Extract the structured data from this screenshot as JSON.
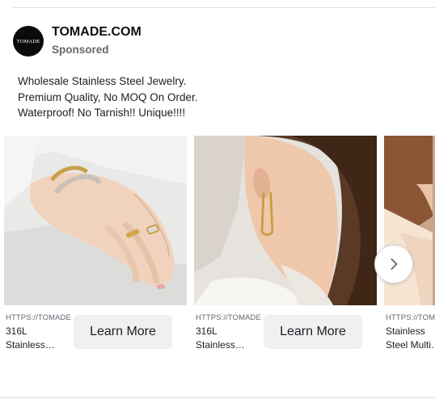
{
  "ad": {
    "advertiser": "TOMADE.COM",
    "avatar_text": "TOMADE",
    "sponsored": "Sponsored",
    "body_lines": [
      "Wholesale Stainless Steel Jewelry.",
      "Premium Quality, No MOQ On Order.",
      "Waterproof! No Tarnish!! Unique!!!!"
    ]
  },
  "carousel": {
    "cards": [
      {
        "image": "hand-with-rings-and-bracelets",
        "url": "HTTPS://TOMADE",
        "title_lines": [
          "316L",
          "Stainless…"
        ],
        "cta": "Learn More"
      },
      {
        "image": "ear-with-gold-earring",
        "url": "HTTPS://TOMADE",
        "title_lines": [
          "316L",
          "Stainless…"
        ],
        "cta": "Learn More"
      },
      {
        "image": "woman-in-cream-blouse",
        "url": "HTTPS://TOM",
        "title_lines": [
          "Stainless",
          "Steel Multi…"
        ],
        "cta": ""
      }
    ],
    "next_icon": "chevron-right-icon"
  },
  "colors": {
    "text_primary": "#1c1e21",
    "text_secondary": "#65676b",
    "button_bg": "#eff0f2",
    "divider": "#dadde1"
  }
}
